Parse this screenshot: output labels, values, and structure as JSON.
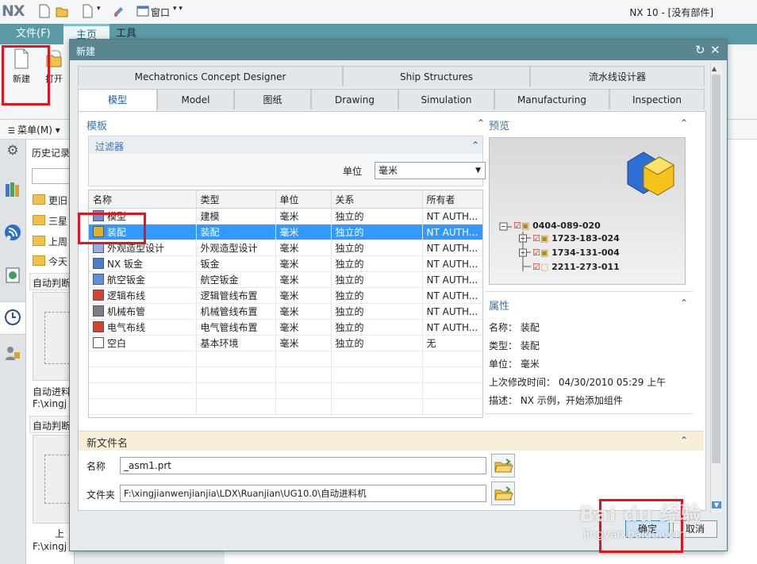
{
  "app": {
    "logo": "NX",
    "window_title": "NX 10 - [没有部件]",
    "quick_menu": "窗口"
  },
  "ribbon": {
    "tabs": [
      "文件(F)",
      "主页",
      "工具"
    ],
    "new_label": "新建",
    "open_label": "打开",
    "menu_label": "菜单(M)"
  },
  "nav": {
    "title": "历史记录",
    "items": [
      "更旧",
      "三星",
      "上周",
      "今天"
    ],
    "card1_title": "自动判断",
    "card1_caption": "自动进料",
    "card1_path": "F:\\xingj",
    "card2_title": "自动判断",
    "card2_caption": "上",
    "card2_path": "F:\\xingj"
  },
  "dialog": {
    "title": "新建",
    "tabs_row1": [
      "Mechatronics Concept Designer",
      "Ship Structures",
      "流水线设计器"
    ],
    "tabs_row2": [
      "模型",
      "Model",
      "图纸",
      "Drawing",
      "Simulation",
      "Manufacturing",
      "Inspection"
    ],
    "template_section": "模板",
    "filter_section": "过滤器",
    "unit_label": "单位",
    "unit_value": "毫米",
    "columns": [
      "名称",
      "类型",
      "单位",
      "关系",
      "所有者"
    ],
    "rows": [
      {
        "name": "模型",
        "type": "建模",
        "unit": "毫米",
        "rel": "独立的",
        "owner": "NT AUTH..."
      },
      {
        "name": "装配",
        "type": "装配",
        "unit": "毫米",
        "rel": "独立的",
        "owner": "NT AUTH..."
      },
      {
        "name": "外观造型设计",
        "type": "外观造型设计",
        "unit": "毫米",
        "rel": "独立的",
        "owner": "NT AUTH..."
      },
      {
        "name": "NX 钣金",
        "type": "钣金",
        "unit": "毫米",
        "rel": "独立的",
        "owner": "NT AUTH..."
      },
      {
        "name": "航空钣金",
        "type": "航空钣金",
        "unit": "毫米",
        "rel": "独立的",
        "owner": "NT AUTH..."
      },
      {
        "name": "逻辑布线",
        "type": "逻辑管线布置",
        "unit": "毫米",
        "rel": "独立的",
        "owner": "NT AUTH..."
      },
      {
        "name": "机械布管",
        "type": "机械管线布置",
        "unit": "毫米",
        "rel": "独立的",
        "owner": "NT AUTH..."
      },
      {
        "name": "电气布线",
        "type": "电气管线布置",
        "unit": "毫米",
        "rel": "独立的",
        "owner": "NT AUTH..."
      },
      {
        "name": "空白",
        "type": "基本环境",
        "unit": "毫米",
        "rel": "独立的",
        "owner": "无"
      }
    ],
    "selected_row": 1,
    "preview_section": "预览",
    "tree": [
      "0404-089-020",
      "1723-183-024",
      "1734-131-004",
      "2211-273-011"
    ],
    "props_section": "属性",
    "props": [
      "名称： 装配",
      "类型： 装配",
      "单位： 毫米",
      "上次修改时间： 04/30/2010 05:29 上午",
      "描述： NX 示例，开始添加组件"
    ],
    "newfile_section": "新文件名",
    "name_label": "名称",
    "name_value": "_asm1.prt",
    "folder_label": "文件夹",
    "folder_value": "F:\\xingjianwenjianjia\\LDX\\Ruanjian\\UG10.0\\自动进料机",
    "ok_label": "确定",
    "cancel_label": "取消"
  },
  "watermark": {
    "main": "Bai du 经验",
    "sub": "jingyan.baidu.com"
  },
  "colors": {
    "accent": "#5a8690",
    "selection": "#3399ff",
    "highlight": "#e3141b",
    "section_text": "#3a73b3"
  }
}
